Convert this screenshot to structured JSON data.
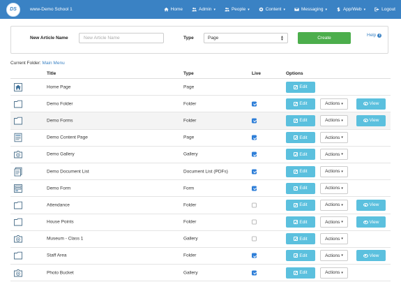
{
  "nav": {
    "logo_text": "DS",
    "brand": "www-Demo School 1",
    "links": [
      {
        "label": "Home",
        "icon": "home-icon",
        "caret": false
      },
      {
        "label": "Admin",
        "icon": "users-icon",
        "caret": true
      },
      {
        "label": "People",
        "icon": "users-icon",
        "caret": true
      },
      {
        "label": "Content",
        "icon": "gear-icon",
        "caret": true
      },
      {
        "label": "Messaging",
        "icon": "envelope-icon",
        "caret": true
      },
      {
        "label": "App/Web",
        "icon": "dollar-icon",
        "caret": true
      },
      {
        "label": "Logout",
        "icon": "logout-icon",
        "caret": false
      }
    ],
    "caret": "▾"
  },
  "form": {
    "name_label": "New Article Name",
    "name_placeholder": "New Article Name",
    "type_label": "Type",
    "type_value": "Page",
    "create_label": "Create",
    "help_label": "Help"
  },
  "breadcrumb": {
    "prefix": "Current Folder:",
    "folder": "Main Menu"
  },
  "table": {
    "headers": {
      "title": "Title",
      "type": "Type",
      "live": "Live",
      "options": "Options"
    },
    "edit_label": "Edit",
    "actions_label": "Actions",
    "view_label": "View",
    "rows": [
      {
        "title": "Home Page",
        "type": "Page",
        "icon": "home-page-icon",
        "live": null,
        "actions": false,
        "view": false
      },
      {
        "title": "Demo Folder",
        "type": "Folder",
        "icon": "folder-icon",
        "live": true,
        "actions": true,
        "view": true
      },
      {
        "title": "Demo Forms",
        "type": "Folder",
        "icon": "folder-icon",
        "live": true,
        "actions": true,
        "view": true
      },
      {
        "title": "Demo Content Page",
        "type": "Page",
        "icon": "page-icon",
        "live": true,
        "actions": true,
        "view": false
      },
      {
        "title": "Demo Gallery",
        "type": "Gallery",
        "icon": "gallery-icon",
        "live": true,
        "actions": true,
        "view": false
      },
      {
        "title": "Demo Document List",
        "type": "Document List (PDFs)",
        "icon": "document-list-icon",
        "live": true,
        "actions": true,
        "view": false
      },
      {
        "title": "Demo Form",
        "type": "Form",
        "icon": "form-icon",
        "live": true,
        "actions": true,
        "view": false
      },
      {
        "title": "Attendance",
        "type": "Folder",
        "icon": "folder-icon",
        "live": false,
        "actions": true,
        "view": true
      },
      {
        "title": "House Points",
        "type": "Folder",
        "icon": "folder-icon",
        "live": false,
        "actions": true,
        "view": true
      },
      {
        "title": "Museum - Class 1",
        "type": "Gallery",
        "icon": "gallery-icon",
        "live": false,
        "actions": true,
        "view": false
      },
      {
        "title": "Staff Area",
        "type": "Folder",
        "icon": "folder-icon",
        "live": true,
        "actions": true,
        "view": true
      },
      {
        "title": "Photo Bucket",
        "type": "Gallery",
        "icon": "gallery-icon",
        "live": true,
        "actions": true,
        "view": false
      }
    ]
  },
  "colors": {
    "navbar": "#3a82c4",
    "create_button": "#4cae4c",
    "info_button": "#5bc0de",
    "link": "#3a82c4",
    "checkbox_on": "#2f7fd8",
    "icon_stroke": "#4a6f8a"
  }
}
